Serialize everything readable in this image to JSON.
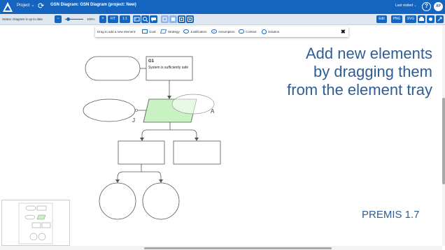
{
  "topbar": {
    "project_label": "Project",
    "title": "GSN Diagram: GSN Diagram (project: New)",
    "last_visited_label": "Last visited",
    "help_label": "?",
    "user_initials": "AP"
  },
  "toolbar": {
    "status": "Status: Diagram is up to date",
    "zoom_out_label": "−",
    "zoom_in_label": "+",
    "zoom_pct": "100%",
    "fit_label": "FIT",
    "one_to_one_label": "1:1",
    "svg_edit_label": "Edit",
    "png_label": "PNG",
    "svg_label": "SVG"
  },
  "tray": {
    "label": "Drag to add a new element:",
    "items": [
      "Goal",
      "Strategy",
      "Justification",
      "Assumption",
      "Context",
      "Solution"
    ],
    "assumption_marker": "A"
  },
  "diagram": {
    "goal_id": "G1",
    "goal_text": "System is sufficiently safe",
    "justification_label": "J",
    "assumption_label": "A"
  },
  "overlay_text": {
    "line1": "Add new elements",
    "line2": "by dragging them",
    "line3": "from the element tray",
    "version": "PREMIS  1.7"
  },
  "colors": {
    "brand": "#1565c0",
    "strategy_fill": "#c8f2c2",
    "overlay_text": "#2f5d96"
  }
}
